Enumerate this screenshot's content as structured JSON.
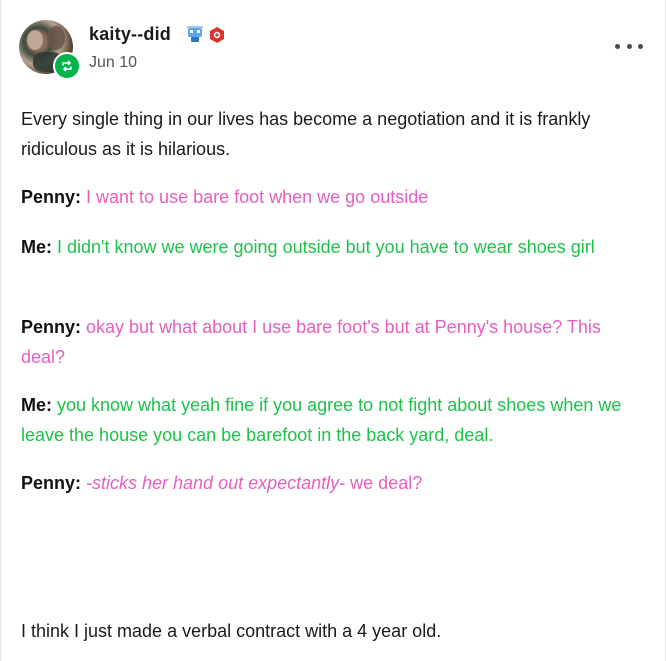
{
  "post": {
    "username": "kaity--did",
    "date": "Jun 10",
    "icons": {
      "avatar": "user-avatar-photo",
      "reblog": "reblog-icon",
      "badges": [
        "blue-robot-badge",
        "red-hexagon-badge"
      ],
      "more": "more-options-icon"
    },
    "colors": {
      "penny": "#e55fc1",
      "me": "#1ec24a",
      "reblog_badge": "#00b34a"
    }
  },
  "content": {
    "intro": "Every single thing in our lives has become a negotiation and it is frankly ridiculous as it is hilarious.",
    "lines": [
      {
        "speaker": "Penny:",
        "text": " I want to use bare foot when we go outside"
      },
      {
        "speaker": "Me:",
        "text": " I didn't know we were going outside but you have to wear shoes girl"
      },
      {
        "speaker": "Penny:",
        "text": " okay but what about I use bare foot's but  at Penny's house? This deal?"
      },
      {
        "speaker": "Me:",
        "text": " you know what yeah fine if you agree to not fight about shoes when we leave the house you can be barefoot in the back yard, deal."
      },
      {
        "speaker": "Penny:",
        "text_italic": " -sticks her hand out expectantly-",
        "text": " we deal?"
      }
    ],
    "outro": "I think I just made a verbal contract with a 4 year old."
  }
}
